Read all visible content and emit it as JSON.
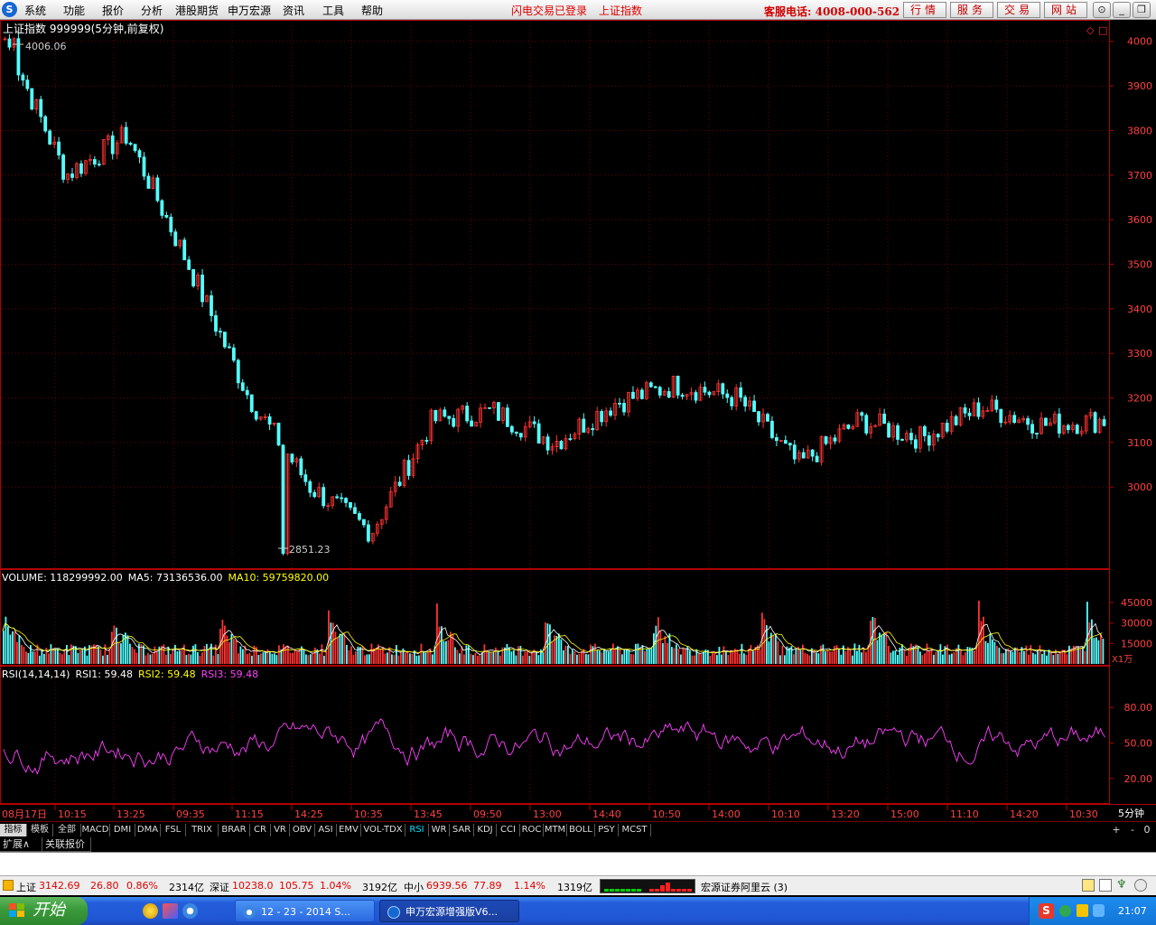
{
  "menubar": {
    "items": [
      "系统",
      "功能",
      "报价",
      "分析",
      "港股期货",
      "申万宏源",
      "资讯",
      "工具",
      "帮助"
    ],
    "status_login": "闪电交易已登录",
    "current_index": "上证指数",
    "hotline": "客服电话: 4008-000-562",
    "quick_buttons": [
      "行情",
      "服务",
      "交易",
      "网站"
    ],
    "window_buttons": [
      "⊙",
      "_",
      "❐",
      "✕"
    ]
  },
  "chart": {
    "title": "上证指数 999999(5分钟,前复权)",
    "high_label": "4006.06",
    "low_label": "2851.23",
    "price_ticks": [
      "4000",
      "3900",
      "3800",
      "3700",
      "3600",
      "3500",
      "3400",
      "3300",
      "3200",
      "3100",
      "3000"
    ],
    "volume_header": {
      "label": "VOLUME: 118299992.00",
      "ma5": "MA5: 73136536.00",
      "ma10": "MA10: 59759820.00"
    },
    "volume_ticks": [
      "45000",
      "30000",
      "15000"
    ],
    "volume_unit": "X1万",
    "rsi_header": {
      "label": "RSI(14,14,14)",
      "rsi1": "RSI1: 59.48",
      "rsi2": "RSI2: 59.48",
      "rsi3": "RSI3: 59.48"
    },
    "rsi_ticks": [
      "80.00",
      "50.00",
      "20.00"
    ],
    "time_labels": [
      "08月17日",
      "10:15",
      "13:25",
      "09:35",
      "11:15",
      "14:25",
      "10:35",
      "13:45",
      "09:50",
      "13:00",
      "14:40",
      "10:50",
      "14:00",
      "10:10",
      "13:20",
      "15:00",
      "11:10",
      "14:20",
      "10:30"
    ],
    "period": "5分钟",
    "colors": {
      "up": "#ff3232",
      "down": "#54ffff",
      "ma5": "#ffffff",
      "ma10": "#ffff00",
      "rsi": "#ff40ff",
      "axis": "#b00000",
      "grid": "#6a0000"
    }
  },
  "chart_data": {
    "type": "line",
    "title": "上证指数 999999(5分钟,前复权)",
    "xlabel": "",
    "ylabel": "",
    "ylim": [
      2820,
      4040
    ],
    "x": [
      "08月17日",
      "10:15",
      "13:25",
      "09:35",
      "11:15",
      "14:25",
      "10:35",
      "13:45",
      "09:50",
      "13:00",
      "14:40",
      "10:50",
      "14:00",
      "10:10",
      "13:20",
      "15:00",
      "11:10",
      "14:20",
      "10:30"
    ],
    "series": [
      {
        "name": "",
        "values": [
          4006,
          3700,
          3790,
          3500,
          3200,
          3000,
          2900,
          3150,
          3170,
          3100,
          3190,
          3230,
          3200,
          3050,
          3150,
          3110,
          3180,
          3140,
          3150
        ]
      }
    ],
    "annotations": [
      {
        "text": "4006.06",
        "value": 4006.06
      },
      {
        "text": "2851.23",
        "value": 2851.23
      }
    ],
    "volume_header": "VOLUME: 118299992.00",
    "rsi_header": "RSI(14,14,14)",
    "grid": true
  },
  "tabs": {
    "items": [
      "指标",
      "模板",
      "全部",
      "MACD",
      "DMI",
      "DMA",
      "FSL",
      "TRIX",
      "BRAR",
      "CR",
      "VR",
      "OBV",
      "ASI",
      "EMV",
      "VOL-TDX",
      "RSI",
      "WR",
      "SAR",
      "KDJ",
      "CCI",
      "ROC",
      "MTM",
      "BOLL",
      "PSY",
      "MCST"
    ],
    "scroll": [
      "+",
      "-",
      "0"
    ]
  },
  "ext_tabs": [
    "扩展∧",
    "关联报价"
  ],
  "status": {
    "sh_name": "上证",
    "sh_val": "3142.69",
    "sh_chg": "26.80",
    "sh_pct": "0.86%",
    "sh_amt": "2314亿",
    "sz_name": "深证",
    "sz_val": "10238.0",
    "sz_chg": "105.75",
    "sz_pct": "1.04%",
    "sz_amt": "3192亿",
    "zx_name": "中小",
    "zx_val": "6939.56",
    "zx_chg": "77.89",
    "zx_pct": "1.14%",
    "zx_amt": "1319亿",
    "server": "宏源证券阿里云 (3)"
  },
  "taskbar": {
    "start": "开始",
    "tasks": [
      "12 - 23 - 2014 S...",
      "申万宏源增强版V6..."
    ],
    "clock": "21:07"
  }
}
